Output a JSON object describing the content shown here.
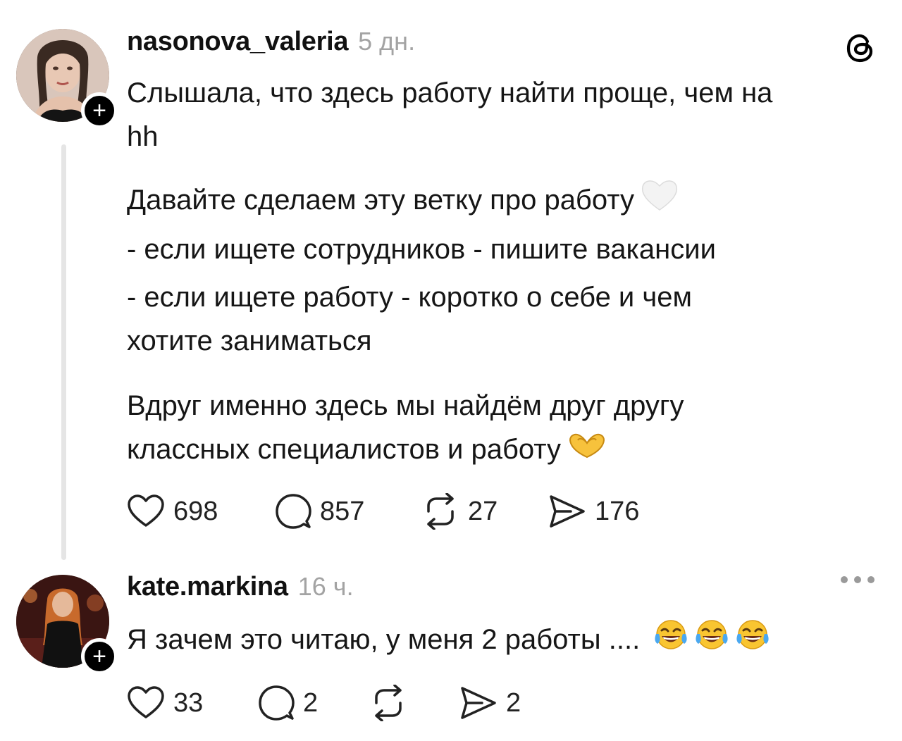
{
  "posts": [
    {
      "username": "nasonova_valeria",
      "time": "5 дн.",
      "lines": [
        "Слышала, что здесь работу найти проще, чем на",
        "hh",
        "Давайте сделаем эту ветку про работу",
        "- если ищете сотрудников - пишите вакансии",
        "- если ищете работу - коротко о себе и чем",
        "хотите заниматься",
        "Вдруг именно здесь мы найдём друг другу",
        "классных специалистов и работу"
      ],
      "emojis": [
        "white-heart-icon",
        "heart-hands-icon"
      ],
      "counts": {
        "likes": "698",
        "comments": "857",
        "reposts": "27",
        "shares": "176"
      }
    },
    {
      "username": "kate.markina",
      "time": "16 ч.",
      "lines": [
        "Я зачем это читаю, у меня 2 работы ...."
      ],
      "emojis": [
        "tears-of-joy-icon",
        "tears-of-joy-icon",
        "tears-of-joy-icon"
      ],
      "counts": {
        "likes": "33",
        "comments": "2",
        "reposts": "",
        "shares": "2"
      }
    }
  ],
  "colors": {
    "text": "#161616",
    "muted": "#a3a3a3",
    "thread_line": "#e5e5e5",
    "accent": "#000000"
  }
}
